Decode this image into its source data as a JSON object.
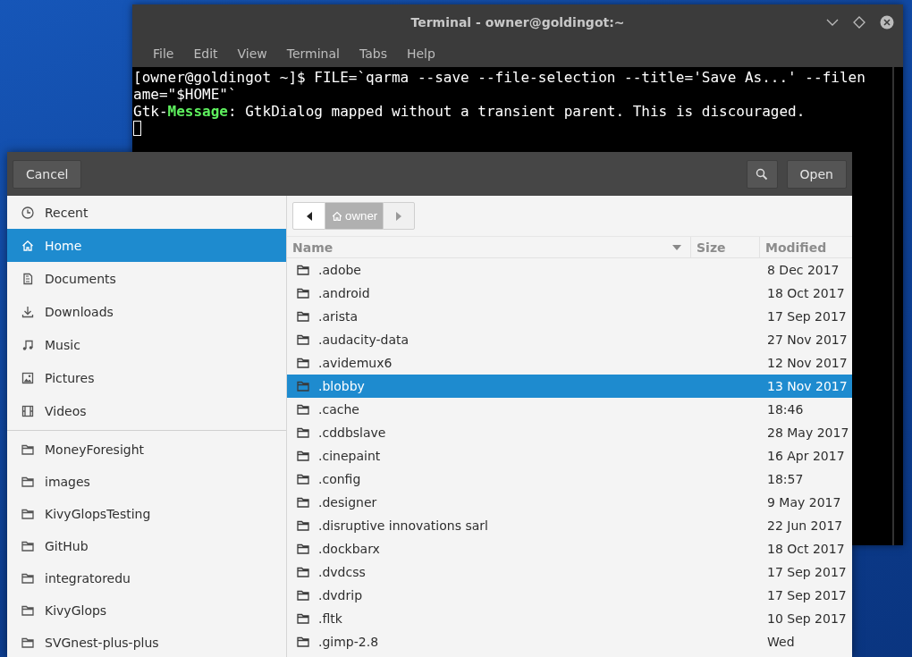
{
  "terminal": {
    "title": "Terminal - owner@goldingot:~",
    "menu": [
      "File",
      "Edit",
      "View",
      "Terminal",
      "Tabs",
      "Help"
    ],
    "lines": [
      [
        {
          "text": "[owner@goldingot ~]$ FILE=`qarma --save --file-selection --title='Save As...' --filen",
          "kind": "plain"
        }
      ],
      [
        {
          "text": "ame=\"$HOME\"`",
          "kind": "plain"
        }
      ],
      [
        {
          "text": "Gtk-",
          "kind": "plain"
        },
        {
          "text": "Message",
          "kind": "highlight"
        },
        {
          "text": ": GtkDialog mapped without a transient parent. This is discouraged.",
          "kind": "plain"
        }
      ]
    ]
  },
  "dialog": {
    "cancel": "Cancel",
    "open": "Open",
    "places": [
      {
        "label": "Recent",
        "kind": "recent",
        "selected": false
      },
      {
        "label": "Home",
        "kind": "home",
        "selected": true
      },
      {
        "label": "Documents",
        "kind": "documents",
        "selected": false
      },
      {
        "label": "Downloads",
        "kind": "downloads",
        "selected": false
      },
      {
        "label": "Music",
        "kind": "music",
        "selected": false
      },
      {
        "label": "Pictures",
        "kind": "pictures",
        "selected": false
      },
      {
        "label": "Videos",
        "kind": "videos",
        "selected": false
      }
    ],
    "bookmarks": [
      {
        "label": "MoneyForesight",
        "selected": false
      },
      {
        "label": "images",
        "selected": false
      },
      {
        "label": "KivyGlopsTesting",
        "selected": false
      },
      {
        "label": "GitHub",
        "selected": false
      },
      {
        "label": "integratoredu",
        "selected": false
      },
      {
        "label": "KivyGlops",
        "selected": false
      },
      {
        "label": "SVGnest-plus-plus",
        "selected": false
      }
    ],
    "path": "owner",
    "columns": [
      "Name",
      "Size",
      "Modified"
    ],
    "rows": [
      {
        "name": ".adobe",
        "modified": "8 Dec 2017",
        "selected": false
      },
      {
        "name": ".android",
        "modified": "18 Oct 2017",
        "selected": false
      },
      {
        "name": ".arista",
        "modified": "17 Sep 2017",
        "selected": false
      },
      {
        "name": ".audacity-data",
        "modified": "27 Nov 2017",
        "selected": false
      },
      {
        "name": ".avidemux6",
        "modified": "12 Nov 2017",
        "selected": false
      },
      {
        "name": ".blobby",
        "modified": "13 Nov 2017",
        "selected": true
      },
      {
        "name": ".cache",
        "modified": "18:46",
        "selected": false
      },
      {
        "name": ".cddbslave",
        "modified": "28 May 2017",
        "selected": false
      },
      {
        "name": ".cinepaint",
        "modified": "16 Apr 2017",
        "selected": false
      },
      {
        "name": ".config",
        "modified": "18:57",
        "selected": false
      },
      {
        "name": ".designer",
        "modified": "9 May 2017",
        "selected": false
      },
      {
        "name": ".disruptive innovations sarl",
        "modified": "22 Jun 2017",
        "selected": false
      },
      {
        "name": ".dockbarx",
        "modified": "18 Oct 2017",
        "selected": false
      },
      {
        "name": ".dvdcss",
        "modified": "17 Sep 2017",
        "selected": false
      },
      {
        "name": ".dvdrip",
        "modified": "17 Sep 2017",
        "selected": false
      },
      {
        "name": ".fltk",
        "modified": "10 Sep 2017",
        "selected": false
      },
      {
        "name": ".gimp-2.8",
        "modified": "Wed",
        "selected": false
      }
    ]
  }
}
